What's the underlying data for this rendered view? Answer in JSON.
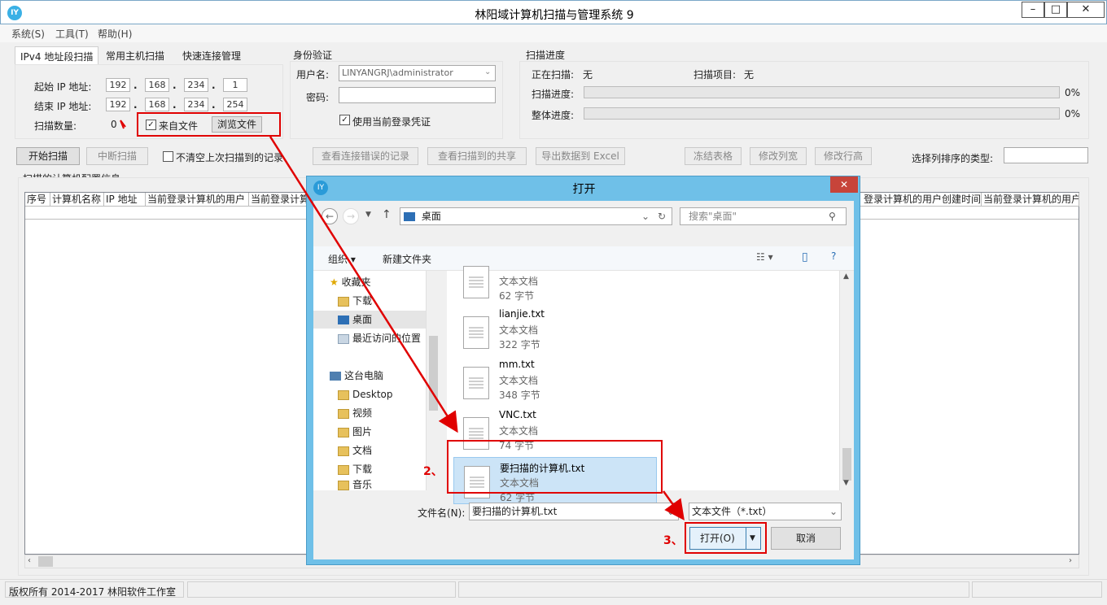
{
  "window": {
    "title": "林阳域计算机扫描与管理系统 9",
    "icon_text": "IY",
    "min_icon": "minimize-icon",
    "max_icon": "maximize-icon",
    "close_icon": "close-icon"
  },
  "menu": [
    "系统(S)",
    "工具(T)",
    "帮助(H)"
  ],
  "tabs": [
    "IPv4 地址段扫描",
    "常用主机扫描",
    "快速连接管理"
  ],
  "scan": {
    "start_ip_label": "起始 IP 地址:",
    "start_ip": [
      "192",
      "168",
      "234",
      "1"
    ],
    "end_ip_label": "结束 IP 地址:",
    "end_ip": [
      "192",
      "168",
      "234",
      "254"
    ],
    "count_label": "扫描数量:",
    "count_value": "0",
    "from_file_label": "来自文件",
    "browse_label": "浏览文件"
  },
  "auth": {
    "title": "身份验证",
    "user_label": "用户名:",
    "user_value": "LINYANGRJ\\administrator",
    "pwd_label": "密码:",
    "use_current_label": "使用当前登录凭证"
  },
  "progress": {
    "title": "扫描进度",
    "scanning_label": "正在扫描:",
    "scanning_value": "无",
    "item_label": "扫描项目:",
    "item_value": "无",
    "scan_label": "扫描进度:",
    "scan_pct": "0%",
    "overall_label": "整体进度:",
    "overall_pct": "0%"
  },
  "buttons": {
    "start": "开始扫描",
    "stop": "中断扫描",
    "keep_label": "不清空上次扫描到的记录",
    "view_errors": "查看连接错误的记录",
    "view_shares": "查看扫描到的共享",
    "export": "导出数据到 Excel",
    "freeze": "冻结表格",
    "col_width": "修改列宽",
    "row_height": "修改行高",
    "sort_label": "选择列排序的类型:"
  },
  "table": {
    "title": "扫描的计算机配置信息",
    "headers": [
      "序号",
      "计算机名称",
      "IP 地址",
      "当前登录计算机的用户",
      "当前登录计算"
    ],
    "right_headers": [
      "登录计算机的用户创建时间",
      "当前登录计算机的用户"
    ]
  },
  "status": {
    "copyright": "版权所有 2014-2017 林阳软件工作室"
  },
  "dialog": {
    "title": "打开",
    "close": "✕",
    "path": "桌面",
    "search_placeholder": "搜索\"桌面\"",
    "organize": "组织 ▾",
    "new_folder": "新建文件夹",
    "tree": [
      {
        "label": "收藏夹",
        "icon": "star-icon"
      },
      {
        "label": "下载",
        "icon": "folder-download-icon"
      },
      {
        "label": "桌面",
        "icon": "desktop-icon"
      },
      {
        "label": "最近访问的位置",
        "icon": "recent-icon"
      },
      {
        "label": "这台电脑",
        "icon": "computer-icon"
      },
      {
        "label": "Desktop",
        "icon": "folder-icon"
      },
      {
        "label": "视频",
        "icon": "video-folder-icon"
      },
      {
        "label": "图片",
        "icon": "picture-folder-icon"
      },
      {
        "label": "文档",
        "icon": "document-folder-icon"
      },
      {
        "label": "下载",
        "icon": "folder-download-icon"
      },
      {
        "label": "音乐",
        "icon": "music-folder-icon"
      }
    ],
    "files": [
      {
        "name": "",
        "type": "文本文档",
        "size": "62 字节"
      },
      {
        "name": "lianjie.txt",
        "type": "文本文档",
        "size": "322 字节"
      },
      {
        "name": "mm.txt",
        "type": "文本文档",
        "size": "348 字节"
      },
      {
        "name": "VNC.txt",
        "type": "文本文档",
        "size": "74 字节"
      },
      {
        "name": "要扫描的计算机.txt",
        "type": "文本文档",
        "size": "62 字节"
      }
    ],
    "filename_label": "文件名(N):",
    "filename_value": "要扫描的计算机.txt",
    "filter_value": "文本文件（*.txt）",
    "open_label": "打开(O)",
    "cancel_label": "取消"
  },
  "annotations": {
    "step2": "2、",
    "step3": "3、"
  },
  "colors": {
    "dialog_frame": "#6fc0e8",
    "selection": "#cce4f7",
    "annotation_red": "#e00000"
  }
}
